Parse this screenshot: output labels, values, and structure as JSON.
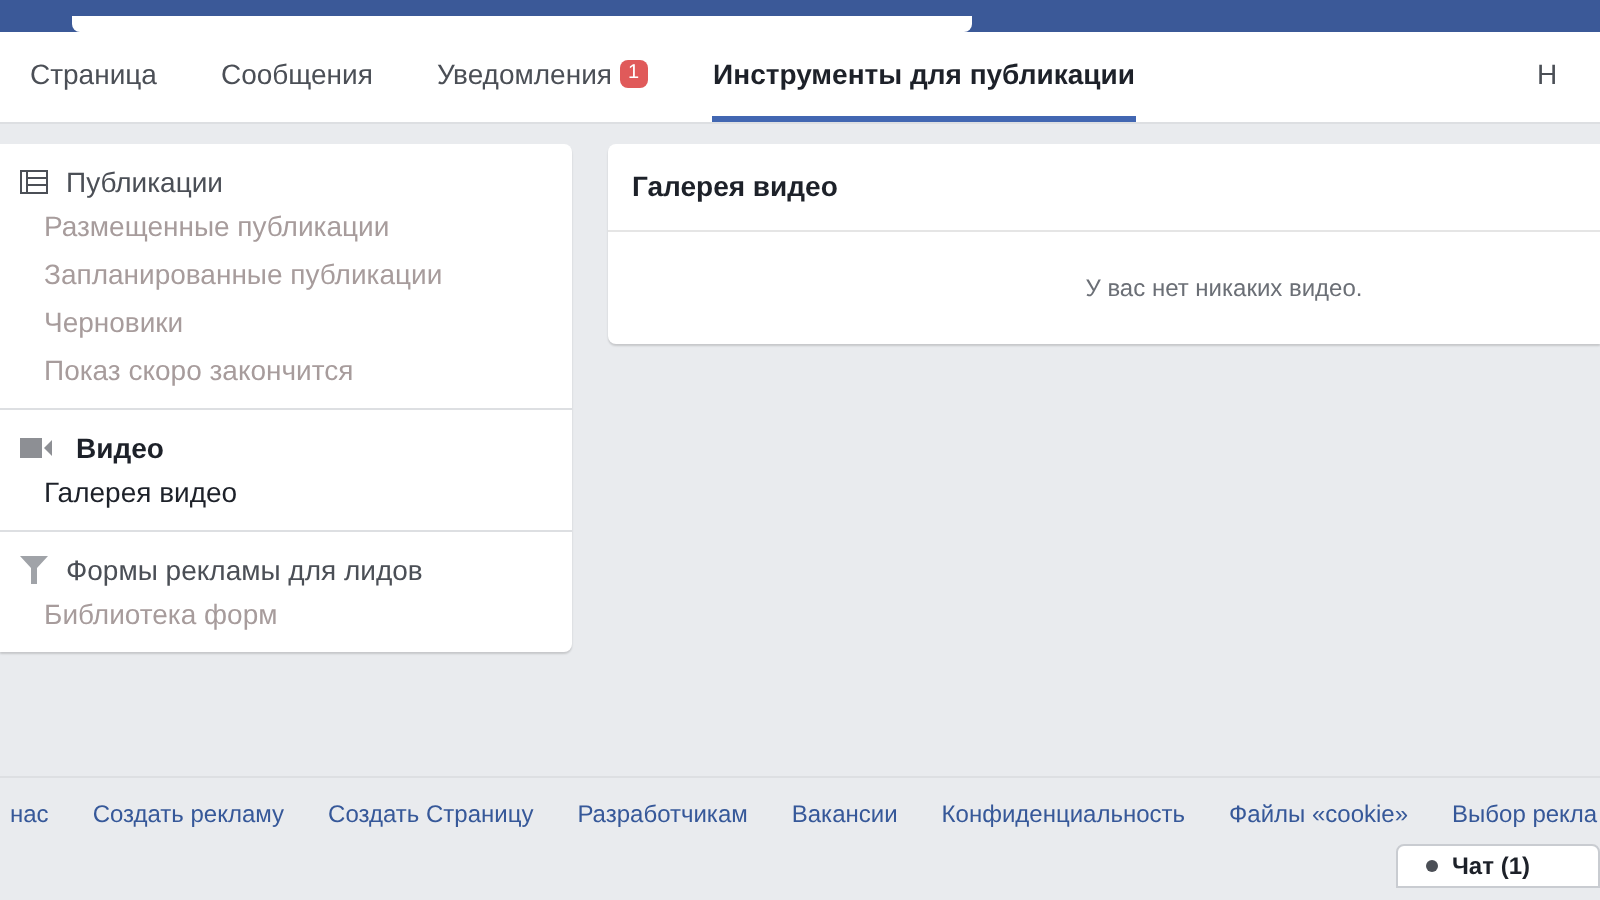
{
  "tabs": [
    {
      "label": "Страница",
      "selected": false
    },
    {
      "label": "Сообщения",
      "selected": false
    },
    {
      "label": "Уведомления",
      "badge": "1",
      "selected": false
    },
    {
      "label": "Инструменты для публикации",
      "selected": true
    },
    {
      "label": "Н",
      "selected": false
    }
  ],
  "sidebar": {
    "sections": [
      {
        "kind": "list",
        "title": "Публикации",
        "active": false,
        "items": [
          {
            "label": "Размещенные публикации",
            "selected": false
          },
          {
            "label": "Запланированные публикации",
            "selected": false
          },
          {
            "label": "Черновики",
            "selected": false
          },
          {
            "label": "Показ скоро закончится",
            "selected": false
          }
        ]
      },
      {
        "kind": "video",
        "title": "Видео",
        "active": true,
        "items": [
          {
            "label": "Галерея видео",
            "selected": true
          }
        ]
      },
      {
        "kind": "filter",
        "title": "Формы рекламы для лидов",
        "active": false,
        "items": [
          {
            "label": "Библиотека форм",
            "selected": false
          }
        ]
      }
    ]
  },
  "panel": {
    "title": "Галерея видео",
    "message": "У вас нет никаких видео."
  },
  "footer": {
    "links": [
      "нас",
      "Создать рекламу",
      "Создать Страницу",
      "Разработчикам",
      "Вакансии",
      "Конфиденциальность",
      "Файлы «cookie»",
      "Выбор рекла"
    ]
  },
  "chat": {
    "label": "Чат (1)"
  }
}
